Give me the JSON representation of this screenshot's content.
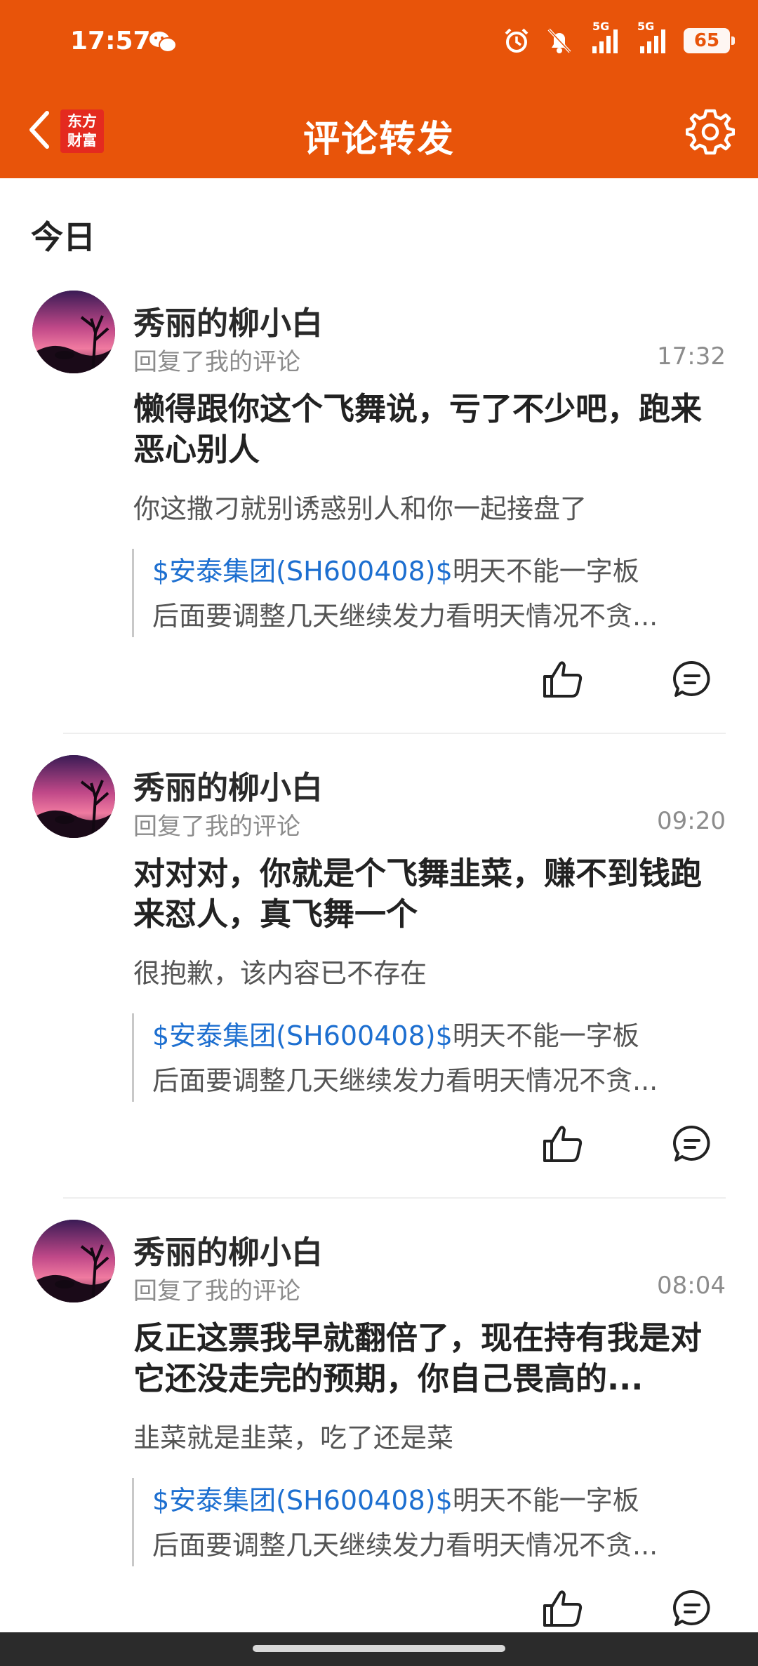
{
  "status_bar": {
    "time": "17:57",
    "battery": "65",
    "network_1": "5G",
    "network_2": "5G"
  },
  "nav": {
    "logo_line1": "东方",
    "logo_line2": "财富",
    "title": "评论转发"
  },
  "section_header": "今日",
  "items": [
    {
      "username": "秀丽的柳小白",
      "reply_label": "回复了我的评论",
      "time": "17:32",
      "content": "懒得跟你这个飞舞说，亏了不少吧，跑来恶心别人",
      "my_comment": "你这撒刁就别诱惑别人和你一起接盘了",
      "quote_stock": "$安泰集团(SH600408)$",
      "quote_rest": "明天不能一字板",
      "quote_line2": "后面要调整几天继续发力看明天情况不贪..."
    },
    {
      "username": "秀丽的柳小白",
      "reply_label": "回复了我的评论",
      "time": "09:20",
      "content": "对对对，你就是个飞舞韭菜，赚不到钱跑来怼人，真飞舞一个",
      "my_comment": " 很抱歉，该内容已不存在",
      "quote_stock": "$安泰集团(SH600408)$",
      "quote_rest": "明天不能一字板",
      "quote_line2": "后面要调整几天继续发力看明天情况不贪..."
    },
    {
      "username": "秀丽的柳小白",
      "reply_label": "回复了我的评论",
      "time": "08:04",
      "content": "反正这票我早就翻倍了，现在持有我是对它还没走完的预期，你自己畏高的...",
      "my_comment": "韭菜就是韭菜，吃了还是菜",
      "quote_stock": "$安泰集团(SH600408)$",
      "quote_rest": "明天不能一字板",
      "quote_line2": "后面要调整几天继续发力看明天情况不贪..."
    }
  ],
  "colors": {
    "brand_orange": "#e8540a",
    "link_blue": "#1d6fd0",
    "logo_red": "#e42a1f"
  },
  "icons": [
    "back-arrow-icon",
    "gear-icon",
    "thumbs-up-icon",
    "comment-icon",
    "alarm-icon",
    "bell-muted-icon",
    "signal-icon",
    "wechat-icon"
  ]
}
